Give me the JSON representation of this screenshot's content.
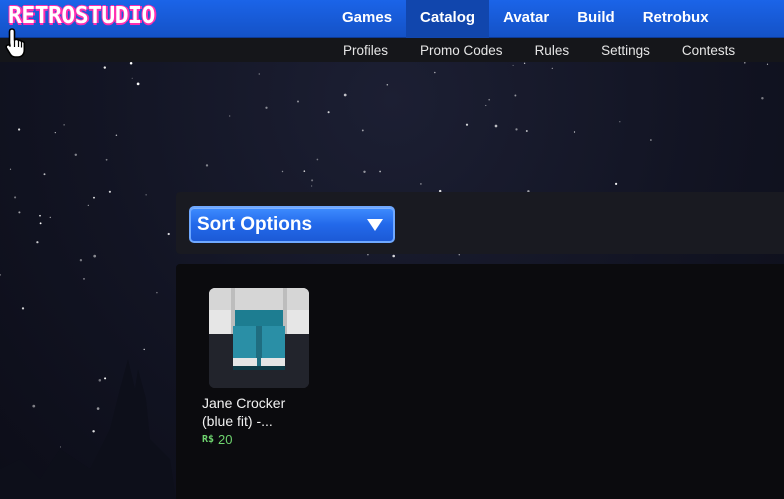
{
  "brand": {
    "logo_text": "RETROSTUDIO",
    "logo_color": "#ff2fb0"
  },
  "main_nav": {
    "items": [
      {
        "label": "Games",
        "active": false
      },
      {
        "label": "Catalog",
        "active": true
      },
      {
        "label": "Avatar",
        "active": false
      },
      {
        "label": "Build",
        "active": false
      },
      {
        "label": "Retrobux",
        "active": false
      }
    ]
  },
  "sub_nav": {
    "items": [
      {
        "label": "Profiles"
      },
      {
        "label": "Promo Codes"
      },
      {
        "label": "Rules"
      },
      {
        "label": "Settings"
      },
      {
        "label": "Contests"
      }
    ]
  },
  "sort": {
    "label": "Sort Options",
    "icon": "triangle-down-icon"
  },
  "catalog": {
    "items": [
      {
        "name": "Jane Crocker (blue fit) -...",
        "currency_symbol": "R$",
        "price": "20",
        "thumbnail": "pants-icon"
      }
    ]
  },
  "colors": {
    "nav_blue": "#1b64e8",
    "active_tab": "#1146ad",
    "price_green": "#6ed36e"
  }
}
